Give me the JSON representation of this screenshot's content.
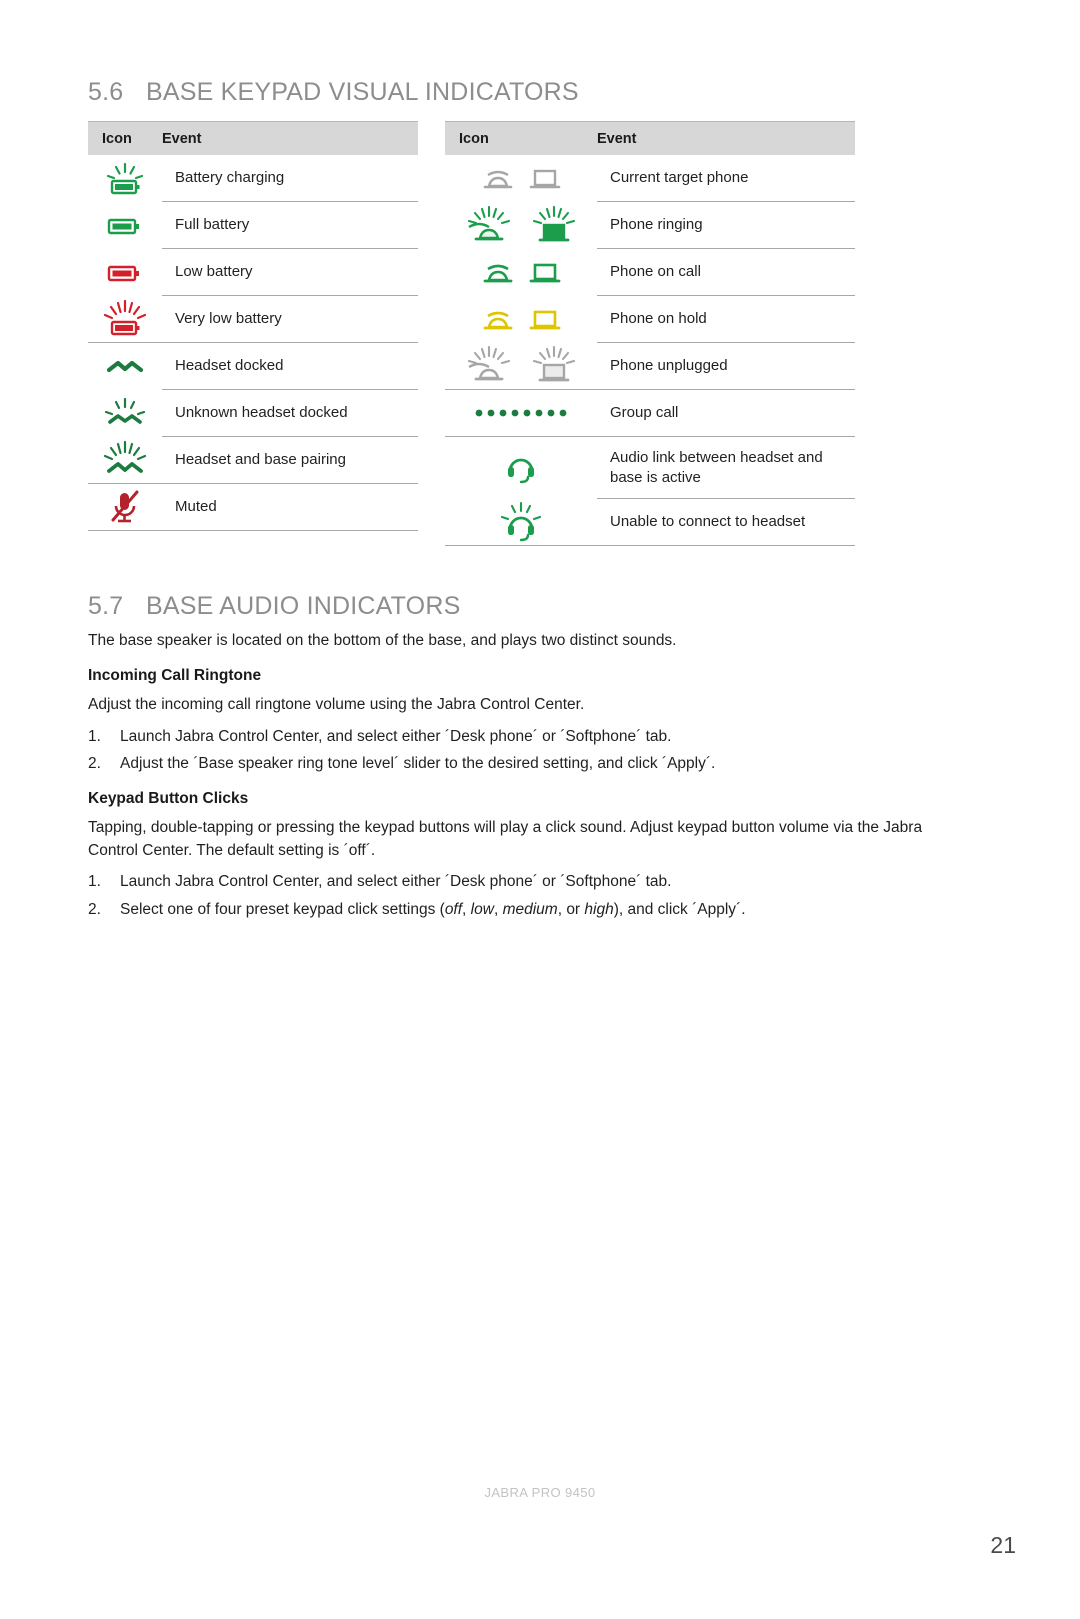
{
  "document": {
    "footer_brand": "JABRA PRO 9450",
    "page_number": "21"
  },
  "sections": {
    "visual_indicators": {
      "number": "5.6",
      "title": "BASE KEYPAD VISUAL INDICATORS",
      "tables": {
        "left": {
          "headers": {
            "icon": "Icon",
            "event": "Event"
          },
          "rows": [
            {
              "event": "Battery charging",
              "icons": [
                "battery-charging-icon"
              ]
            },
            {
              "event": "Full battery",
              "icons": [
                "battery-full-icon"
              ]
            },
            {
              "event": "Low battery",
              "icons": [
                "battery-low-icon"
              ]
            },
            {
              "event": "Very low battery",
              "icons": [
                "battery-very-low-icon"
              ]
            },
            {
              "event": "Headset docked",
              "icons": [
                "headset-docked-icon"
              ]
            },
            {
              "event": "Unknown headset docked",
              "icons": [
                "unknown-headset-docked-icon"
              ]
            },
            {
              "event": "Headset and base pairing",
              "icons": [
                "headset-base-pairing-icon"
              ]
            },
            {
              "event": "Muted",
              "icons": [
                "muted-microphone-icon"
              ]
            }
          ]
        },
        "right": {
          "headers": {
            "icon": "Icon",
            "event": "Event"
          },
          "rows": [
            {
              "event": "Current target phone",
              "icons": [
                "deskphone-grey-icon",
                "softphone-grey-icon"
              ]
            },
            {
              "event": "Phone ringing",
              "icons": [
                "deskphone-ringing-icon",
                "softphone-ringing-icon"
              ]
            },
            {
              "event": "Phone on call",
              "icons": [
                "deskphone-green-icon",
                "softphone-green-icon"
              ]
            },
            {
              "event": "Phone on hold",
              "icons": [
                "deskphone-yellow-icon",
                "softphone-yellow-icon"
              ]
            },
            {
              "event": "Phone unplugged",
              "icons": [
                "deskphone-unplugged-icon",
                "softphone-unplugged-icon"
              ]
            },
            {
              "event": "Group call",
              "icons": [
                "group-call-dots-icon"
              ]
            },
            {
              "event": "Audio link between headset and base is active",
              "icons": [
                "headset-link-active-icon"
              ]
            },
            {
              "event": "Unable to connect to headset",
              "icons": [
                "headset-unable-connect-icon"
              ]
            }
          ]
        }
      }
    },
    "audio_indicators": {
      "number": "5.7",
      "title": "BASE AUDIO INDICATORS",
      "intro": "The base speaker is located on the bottom of the base, and plays two distinct sounds.",
      "ringtone": {
        "heading": "Incoming Call Ringtone",
        "paragraph": "Adjust the incoming call ringtone volume using the Jabra Control Center.",
        "steps": [
          {
            "num": "1.",
            "text": "Launch Jabra Control Center, and select either ´Desk phone´ or ´Softphone´ tab."
          },
          {
            "num": "2.",
            "text": "Adjust the ´Base speaker ring tone level´ slider to the desired setting, and click ´Apply´."
          }
        ]
      },
      "keypad_clicks": {
        "heading": "Keypad Button Clicks",
        "paragraph": "Tapping, double-tapping or pressing the keypad buttons will play a click sound. Adjust keypad button volume via the Jabra Control Center. The default setting is ´off´.",
        "steps": [
          {
            "num": "1.",
            "text": "Launch Jabra Control Center, and select either ´Desk phone´ or ´Softphone´ tab."
          }
        ],
        "final_step": {
          "num": "2.",
          "pre": "Select one of four preset keypad click settings (",
          "opt1": "off",
          "sep1": ", ",
          "opt2": "low",
          "sep2": ", ",
          "opt3": "medium",
          "sep3": ", or ",
          "opt4": "high",
          "post": "), and click ´Apply´."
        }
      }
    }
  },
  "colors": {
    "green": "#1c9d4c",
    "red": "#d3202a",
    "yellow": "#ddc500",
    "grey_icon": "#a6a6a6",
    "header_bg": "#d7d7d7",
    "rule": "#a8a8a8",
    "heading": "#8d8d8d"
  }
}
